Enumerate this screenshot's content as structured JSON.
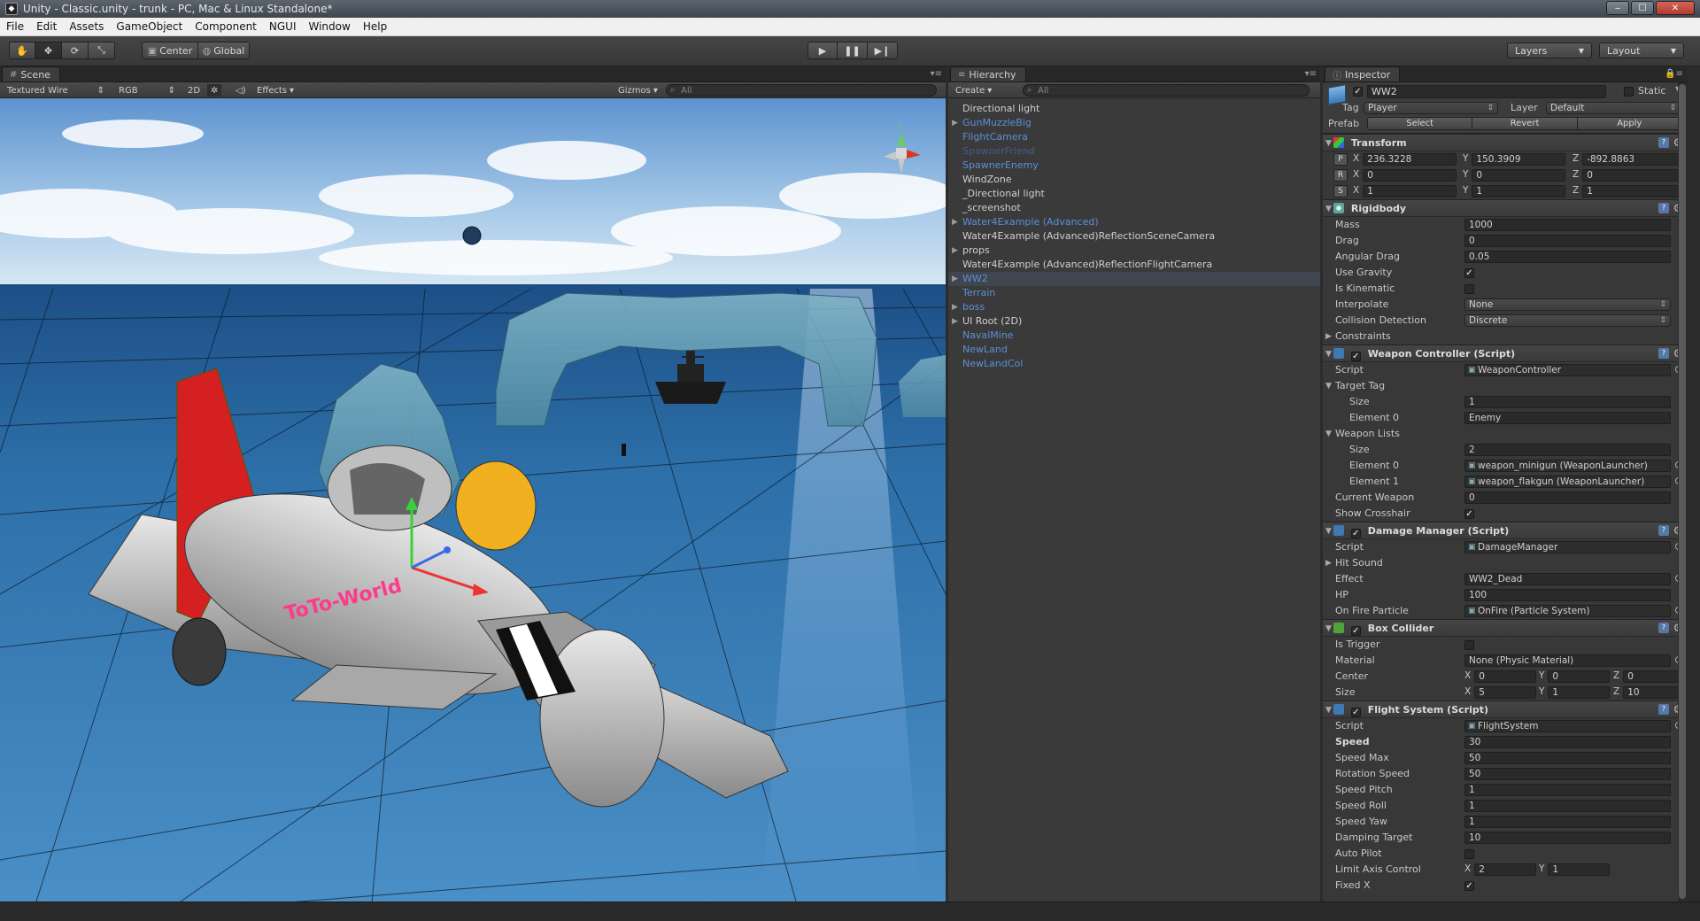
{
  "window": {
    "title": "Unity - Classic.unity - trunk - PC, Mac & Linux Standalone*",
    "app_icon": "unity-icon"
  },
  "menu": [
    "File",
    "Edit",
    "Assets",
    "GameObject",
    "Component",
    "NGUI",
    "Window",
    "Help"
  ],
  "toolbar": {
    "pivot": "Center",
    "space": "Global",
    "layers": "Layers",
    "layout": "Layout"
  },
  "scene": {
    "tab": "Scene",
    "draw_mode": "Textured Wire",
    "render_mode": "RGB",
    "mode_2d": "2D",
    "effects": "Effects",
    "gizmos": "Gizmos",
    "search": "All",
    "plane_text": "ToTo-World"
  },
  "hierarchy": {
    "tab": "Hierarchy",
    "create": "Create",
    "search": "All",
    "items": [
      {
        "label": "Directional light",
        "kind": "normal",
        "arrow": ""
      },
      {
        "label": "GunMuzzleBig",
        "kind": "prefab",
        "arrow": "▶"
      },
      {
        "label": "FlightCamera",
        "kind": "prefab",
        "arrow": ""
      },
      {
        "label": "SpawnerFriend",
        "kind": "prefab-missing",
        "arrow": ""
      },
      {
        "label": "SpawnerEnemy",
        "kind": "prefab",
        "arrow": ""
      },
      {
        "label": "WindZone",
        "kind": "normal",
        "arrow": ""
      },
      {
        "label": "_Directional light",
        "kind": "normal",
        "arrow": ""
      },
      {
        "label": "_screenshot",
        "kind": "normal",
        "arrow": ""
      },
      {
        "label": "Water4Example (Advanced)",
        "kind": "prefab",
        "arrow": "▶"
      },
      {
        "label": "Water4Example (Advanced)ReflectionSceneCamera",
        "kind": "normal",
        "arrow": ""
      },
      {
        "label": "props",
        "kind": "normal",
        "arrow": "▶"
      },
      {
        "label": "Water4Example (Advanced)ReflectionFlightCamera",
        "kind": "normal",
        "arrow": ""
      },
      {
        "label": "WW2",
        "kind": "prefab",
        "arrow": "▶",
        "selected": true
      },
      {
        "label": "Terrain",
        "kind": "prefab",
        "arrow": ""
      },
      {
        "label": "boss",
        "kind": "prefab",
        "arrow": "▶"
      },
      {
        "label": "UI Root (2D)",
        "kind": "normal",
        "arrow": "▶"
      },
      {
        "label": "NavalMine",
        "kind": "prefab",
        "arrow": ""
      },
      {
        "label": "NewLand",
        "kind": "prefab",
        "arrow": ""
      },
      {
        "label": "NewLandCol",
        "kind": "prefab",
        "arrow": ""
      }
    ]
  },
  "inspector": {
    "tab": "Inspector",
    "object_name": "WW2",
    "static_label": "Static",
    "tag_label": "Tag",
    "tag_value": "Player",
    "layer_label": "Layer",
    "layer_value": "Default",
    "prefab_label": "Prefab",
    "prefab_select": "Select",
    "prefab_revert": "Revert",
    "prefab_apply": "Apply",
    "transform": {
      "title": "Transform",
      "position": {
        "x": "236.3228",
        "y": "150.3909",
        "z": "-892.8863"
      },
      "rotation": {
        "x": "0",
        "y": "0",
        "z": "0"
      },
      "scale": {
        "x": "1",
        "y": "1",
        "z": "1"
      }
    },
    "rigidbody": {
      "title": "Rigidbody",
      "rows": [
        {
          "label": "Mass",
          "value": "1000",
          "type": "field"
        },
        {
          "label": "Drag",
          "value": "0",
          "type": "field"
        },
        {
          "label": "Angular Drag",
          "value": "0.05",
          "type": "field"
        },
        {
          "label": "Use Gravity",
          "value": "✓",
          "type": "check"
        },
        {
          "label": "Is Kinematic",
          "value": "",
          "type": "check"
        },
        {
          "label": "Interpolate",
          "value": "None",
          "type": "select"
        },
        {
          "label": "Collision Detection",
          "value": "Discrete",
          "type": "select"
        }
      ],
      "constraints": "Constraints"
    },
    "weapon_controller": {
      "title": "Weapon Controller (Script)",
      "script_label": "Script",
      "script_value": "WeaponController",
      "target_tag": "Target Tag",
      "tt_size_label": "Size",
      "tt_size": "1",
      "tt_el0_label": "Element 0",
      "tt_el0": "Enemy",
      "weapon_lists": "Weapon Lists",
      "wl_size_label": "Size",
      "wl_size": "2",
      "wl_el0_label": "Element 0",
      "wl_el0": "weapon_minigun (WeaponLauncher)",
      "wl_el1_label": "Element 1",
      "wl_el1": "weapon_flakgun (WeaponLauncher)",
      "current_weapon_label": "Current Weapon",
      "current_weapon": "0",
      "show_crosshair_label": "Show Crosshair",
      "show_crosshair": "✓"
    },
    "damage_manager": {
      "title": "Damage Manager (Script)",
      "script_label": "Script",
      "script_value": "DamageManager",
      "hit_sound": "Hit Sound",
      "effect_label": "Effect",
      "effect": "WW2_Dead",
      "hp_label": "HP",
      "hp": "100",
      "onfire_label": "On Fire Particle",
      "onfire": "OnFire (Particle System)"
    },
    "box_collider": {
      "title": "Box Collider",
      "trigger_label": "Is Trigger",
      "material_label": "Material",
      "material": "None (Physic Material)",
      "center_label": "Center",
      "center": {
        "x": "0",
        "y": "0",
        "z": "0"
      },
      "size_label": "Size",
      "size": {
        "x": "5",
        "y": "1",
        "z": "10"
      }
    },
    "flight_system": {
      "title": "Flight System (Script)",
      "script_label": "Script",
      "script_value": "FlightSystem",
      "rows": [
        {
          "label": "Speed",
          "value": "30",
          "bold": true
        },
        {
          "label": "Speed Max",
          "value": "50"
        },
        {
          "label": "Rotation Speed",
          "value": "50"
        },
        {
          "label": "Speed Pitch",
          "value": "1"
        },
        {
          "label": "Speed Roll",
          "value": "1"
        },
        {
          "label": "Speed Yaw",
          "value": "1"
        },
        {
          "label": "Damping Target",
          "value": "10"
        }
      ],
      "autopilot_label": "Auto Pilot",
      "limit_label": "Limit Axis Control",
      "limit": {
        "x": "2",
        "y": "1"
      },
      "fixedx_label": "Fixed X",
      "fixedx": "✓"
    }
  },
  "colors": {
    "sky": "#9fc3e6",
    "sea": "#2d6fa8",
    "prefab_text": "#5b90d8",
    "panel_bg": "#383838",
    "plane_red": "#d42020"
  }
}
